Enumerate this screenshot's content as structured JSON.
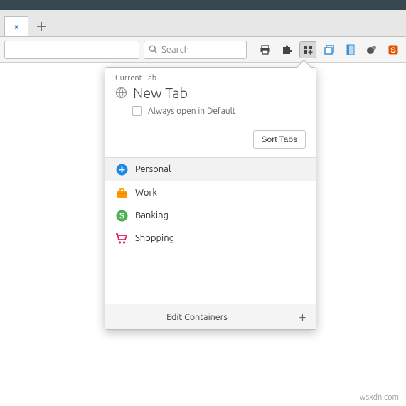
{
  "window": {
    "tab_close": "×"
  },
  "toolbar": {
    "search_placeholder": "Search",
    "icons": {
      "print": "print-icon",
      "puzzle": "puzzle-icon",
      "containers": "containers-icon",
      "windows": "windows-icon",
      "book": "book-icon",
      "globe": "globe-icon",
      "stylus": "stylus-icon"
    }
  },
  "panel": {
    "section_label": "Current Tab",
    "tab_title": "New Tab",
    "always_label": "Always open in Default",
    "sort_label": "Sort Tabs",
    "containers": [
      {
        "name": "Personal",
        "color": "#1e88e5",
        "icon": "plus-circle",
        "selected": true
      },
      {
        "name": "Work",
        "color": "#ff9800",
        "icon": "briefcase",
        "selected": false
      },
      {
        "name": "Banking",
        "color": "#4caf50",
        "icon": "dollar",
        "selected": false
      },
      {
        "name": "Shopping",
        "color": "#e91e63",
        "icon": "cart",
        "selected": false
      }
    ],
    "edit_label": "Edit Containers",
    "add_label": "+"
  },
  "watermark": "wsxdn.com"
}
